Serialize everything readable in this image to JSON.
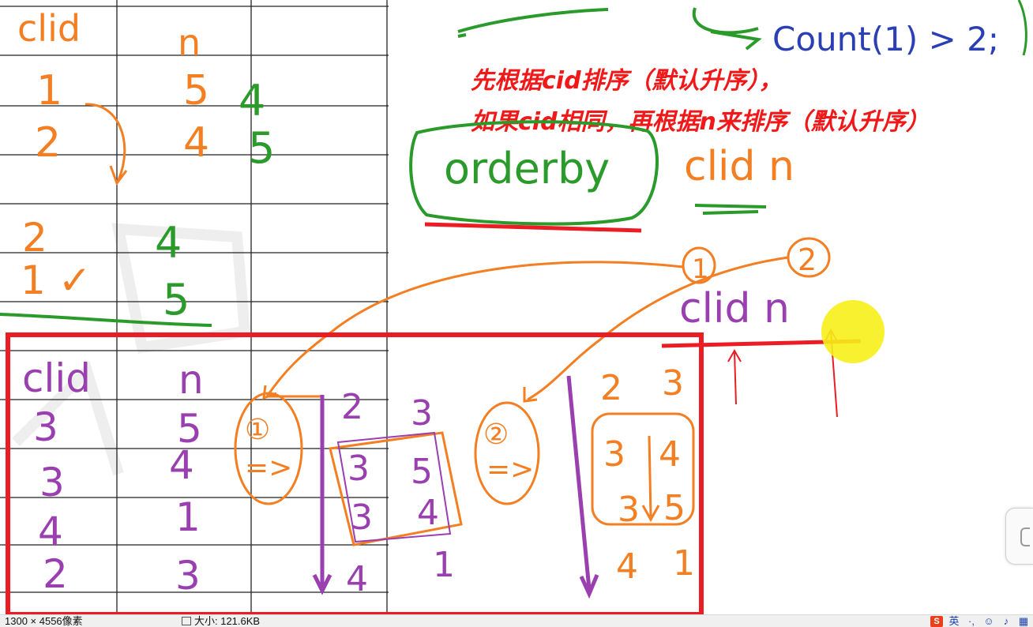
{
  "colors": {
    "orange": "#f47e22",
    "green": "#2a9a2a",
    "purple": "#9a3fb0",
    "blue": "#2a3fb4",
    "red": "#ec1c24",
    "yellow": "#f6ef1a"
  },
  "top_table": {
    "header": {
      "cid": "clid",
      "n": "n"
    },
    "rows": [
      {
        "cid": "1",
        "n": "5",
        "side": "4"
      },
      {
        "cid": "2",
        "n": "4",
        "side": "5"
      },
      {
        "cid": "2",
        "n": "4",
        "side": ""
      },
      {
        "cid": "1 ✓",
        "n": "5",
        "side": ""
      }
    ]
  },
  "bottom_table": {
    "header": {
      "cid": "clid",
      "n": "n"
    },
    "rows": [
      {
        "cid": "3",
        "n": "5"
      },
      {
        "cid": "3",
        "n": "4"
      },
      {
        "cid": "4",
        "n": "1"
      },
      {
        "cid": "2",
        "n": "3"
      }
    ]
  },
  "sort_step1": {
    "marker": "①",
    "arrow": "=>",
    "pairs": [
      [
        "2",
        "3"
      ],
      [
        "3",
        "5"
      ],
      [
        "3",
        "4"
      ],
      [
        "4",
        "1"
      ]
    ]
  },
  "sort_step2": {
    "marker": "②",
    "arrow": "=>",
    "pairs": [
      [
        "2",
        "3"
      ],
      [
        "3",
        "4"
      ],
      [
        "3",
        "5"
      ],
      [
        "4",
        "1"
      ]
    ]
  },
  "annotations": {
    "count_text": "Count(1) > 2;",
    "note_line1": "先根据cid排序（默认升序），",
    "note_line2": "如果cid相同，再根据n来排序（默认升序）",
    "orderby_text": "orderby",
    "orderby_args": "clid n",
    "cols_text": "clid n",
    "label_1": "1",
    "label_2": "2"
  },
  "status_bar": {
    "dimensions": "1300 × 4556像素",
    "size": "大小: 121.6KB"
  },
  "tray": {
    "s_logo": "S",
    "lang": "英"
  }
}
